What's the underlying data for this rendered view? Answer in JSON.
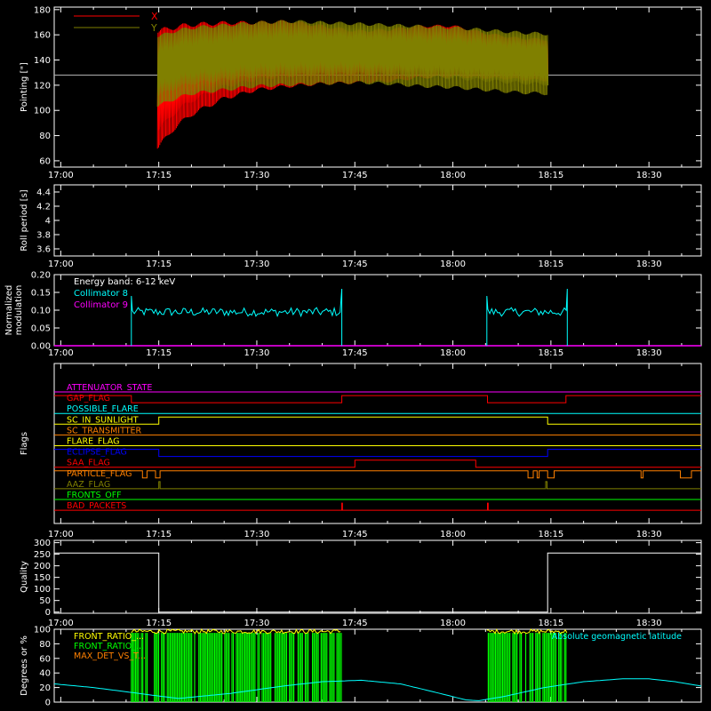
{
  "figure": {
    "background": "#000000",
    "foreground": "#ffffff"
  },
  "time_axis": {
    "ticks": [
      "17:00",
      "17:15",
      "17:30",
      "17:45",
      "18:00",
      "18:15",
      "18:30"
    ],
    "tick_minutes": [
      0,
      15,
      30,
      45,
      60,
      75,
      90
    ],
    "range_minutes": [
      -1,
      98
    ]
  },
  "chart_data": [
    {
      "id": "pointing",
      "type": "line",
      "ylabel": "Pointing [\"]",
      "ylim": [
        55,
        182
      ],
      "yticks": [
        60,
        80,
        100,
        120,
        140,
        160,
        180
      ],
      "reference_line": {
        "y": 128,
        "color": "#b0b0b0"
      },
      "series": [
        {
          "name": "X",
          "color": "#ff0000",
          "t_start": 14.8,
          "t_end": 74.5,
          "envelope_t": [
            15,
            17,
            20,
            25,
            30,
            35,
            40,
            45,
            50,
            55,
            60,
            65,
            70,
            74.5
          ],
          "envelope_low": [
            68,
            82,
            95,
            108,
            115,
            118,
            120,
            121,
            122,
            125,
            126,
            125,
            124,
            123
          ],
          "envelope_high": [
            165,
            168,
            170,
            171,
            171,
            172,
            168,
            164,
            165,
            168,
            168,
            162,
            158,
            157
          ]
        },
        {
          "name": "Y",
          "color": "#808000",
          "t_start": 14.8,
          "t_end": 74.5,
          "envelope_t": [
            15,
            17,
            20,
            25,
            30,
            35,
            40,
            45,
            50,
            55,
            60,
            65,
            70,
            74.5
          ],
          "envelope_low": [
            102,
            107,
            112,
            115,
            118,
            119,
            120,
            121,
            120,
            118,
            117,
            115,
            113,
            112
          ],
          "envelope_high": [
            160,
            164,
            167,
            169,
            171,
            172,
            171,
            170,
            169,
            168,
            167,
            165,
            163,
            162
          ]
        }
      ]
    },
    {
      "id": "roll_period",
      "type": "line",
      "ylabel": "Roll period [s]",
      "ylim": [
        3.5,
        4.5
      ],
      "yticks": [
        3.6,
        3.8,
        4.0,
        4.2,
        4.4
      ],
      "series": []
    },
    {
      "id": "modulation",
      "type": "line",
      "ylabel": "Normalized modulation",
      "ylabel_lines": [
        "Normalized",
        "modulation"
      ],
      "ylim": [
        0.0,
        0.2
      ],
      "yticks": [
        0.0,
        0.05,
        0.1,
        0.15,
        0.2
      ],
      "ytick_labels": [
        "0.00",
        "0.05",
        "0.10",
        "0.15",
        "0.20"
      ],
      "legend_title": "Energy band: 6-12 keV",
      "series": [
        {
          "name": "Collimator 8",
          "color": "#00ffff",
          "segments": [
            {
              "t_start": 10.8,
              "t_end": 43.0,
              "mean": 0.095,
              "spread": 0.012,
              "spikes": [
                [
                  11,
                  0.14
                ],
                [
                  43,
                  0.16
                ]
              ]
            },
            {
              "t_start": 65.2,
              "t_end": 77.5,
              "mean": 0.095,
              "spread": 0.012,
              "spikes": [
                [
                  65.3,
                  0.14
                ],
                [
                  77.3,
                  0.16
                ]
              ]
            }
          ]
        },
        {
          "name": "Collimator 9",
          "color": "#ff00ff",
          "constant": 0.0
        }
      ]
    },
    {
      "id": "flags",
      "type": "line",
      "ylabel": "Flags",
      "flags": [
        {
          "name": "ATTENUATOR_STATE",
          "color": "#ff00ff",
          "transitions": [],
          "start": 0
        },
        {
          "name": "GAP_FLAG",
          "color": "#ff0000",
          "transitions": [
            10.8,
            43.0,
            65.3,
            77.3
          ],
          "start": 1
        },
        {
          "name": "POSSIBLE_FLARE",
          "color": "#00ffff",
          "transitions": [],
          "start": 0
        },
        {
          "name": "SC_IN_SUNLIGHT",
          "color": "#ffff00",
          "transitions": [
            15.0,
            74.5
          ],
          "start": 0
        },
        {
          "name": "SC_TRANSMITTER",
          "color": "#ff8000",
          "transitions": [],
          "start": 0
        },
        {
          "name": "FLARE_FLAG",
          "color": "#ffff00",
          "transitions": [],
          "start": 0
        },
        {
          "name": "ECLIPSE_FLAG",
          "color": "#0000ff",
          "transitions": [
            15.0,
            74.5
          ],
          "start": 1
        },
        {
          "name": "SAA_FLAG",
          "color": "#ff0000",
          "transitions": [
            45.0,
            63.5
          ],
          "start": 0
        },
        {
          "name": "PARTICLE_FLAG",
          "color": "#ff8000",
          "transitions": [
            12.5,
            13.2,
            14.5,
            15.2,
            71.5,
            72.3,
            72.9,
            73.2,
            74.5,
            75.5,
            88.8,
            89.1,
            94.8,
            96.5
          ],
          "start": 1
        },
        {
          "name": "AAZ_FLAG",
          "color": "#808000",
          "transitions": [
            15.0,
            15.2,
            74.2,
            74.4
          ],
          "start": 0
        },
        {
          "name": "FRONTS_OFF",
          "color": "#00ff00",
          "transitions": [],
          "start": 0
        },
        {
          "name": "BAD_PACKETS",
          "color": "#ff0000",
          "transitions": [
            43.0,
            43.1,
            65.3,
            65.4
          ],
          "start": 0
        }
      ]
    },
    {
      "id": "quality",
      "type": "line",
      "ylabel": "Quality",
      "ylim": [
        -5,
        310
      ],
      "yticks": [
        0,
        50,
        100,
        150,
        200,
        250,
        300
      ],
      "series": [
        {
          "name": "",
          "color": "#ffffff",
          "t": [
            -1,
            15,
            15,
            74.5,
            74.5,
            98
          ],
          "values": [
            255,
            255,
            0,
            0,
            255,
            255
          ]
        }
      ]
    },
    {
      "id": "geomagnetic",
      "type": "area",
      "ylabel": "Degrees or %",
      "ylim": [
        0,
        100
      ],
      "yticks": [
        0,
        20,
        40,
        60,
        80,
        100
      ],
      "legend": [
        {
          "name": "FRONT_RATIO_...",
          "color": "#ffff00"
        },
        {
          "name": "FRONT_RATIO_...",
          "color": "#00ff00"
        },
        {
          "name": "MAX_DET_VS_T...",
          "color": "#ff8000"
        }
      ],
      "right_label": {
        "text": "Absolute geomagnetic latitude",
        "color": "#00ffff"
      },
      "series": [
        {
          "name": "FRONT_RATIO_...",
          "color": "#00ff00",
          "segments": [
            {
              "t_start": 10.8,
              "t_end": 43.0
            },
            {
              "t_start": 65.2,
              "t_end": 77.5
            }
          ],
          "top": 95
        },
        {
          "name": "Absolute geomagnetic latitude",
          "color": "#00ffff",
          "t": [
            -1,
            5,
            11,
            18,
            26,
            34,
            40,
            46,
            52,
            58,
            62,
            64,
            68,
            74,
            80,
            86,
            90,
            94,
            98
          ],
          "values": [
            25,
            20,
            13,
            5,
            12,
            22,
            28,
            30,
            25,
            12,
            3,
            2,
            8,
            20,
            28,
            32,
            32,
            28,
            22
          ]
        }
      ]
    }
  ]
}
